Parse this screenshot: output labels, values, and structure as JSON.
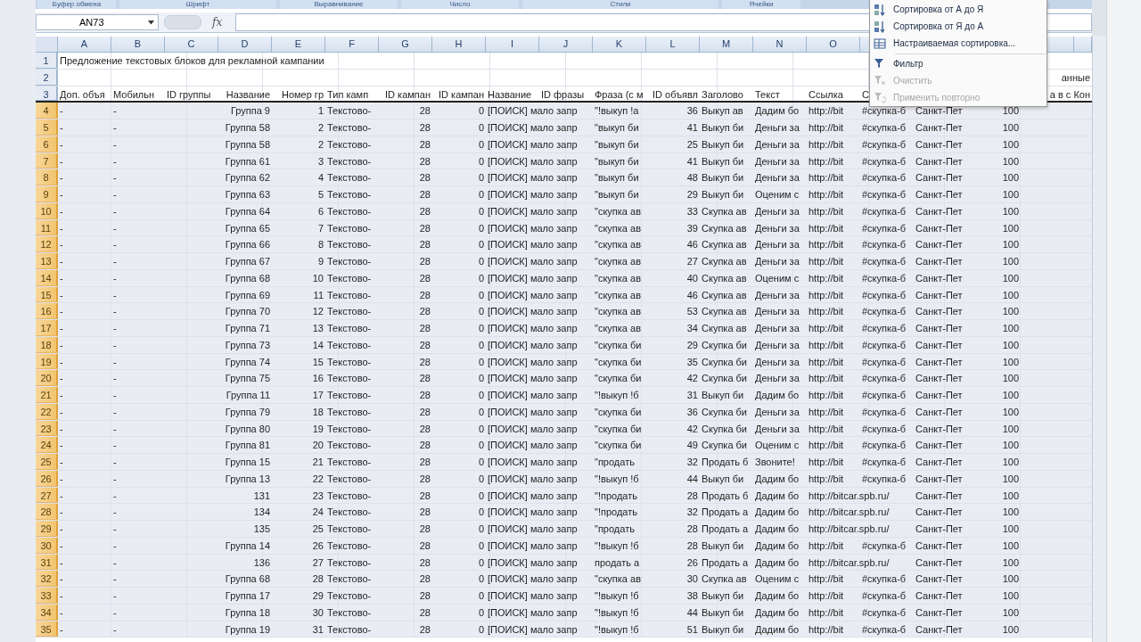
{
  "ribbon_groups": [
    {
      "label": "Буфер обмена"
    },
    {
      "label": "Шрифт"
    },
    {
      "label": "Выравнивание"
    },
    {
      "label": "Число"
    },
    {
      "label": "Стили"
    },
    {
      "label": "Ячейки"
    }
  ],
  "formula_bar": {
    "name_box": "AN73",
    "fx": "fx"
  },
  "columns": [
    "A",
    "B",
    "C",
    "D",
    "E",
    "F",
    "G",
    "H",
    "I",
    "J",
    "K",
    "L",
    "M",
    "N",
    "O"
  ],
  "rows": [
    {
      "num": "1",
      "kind": "title",
      "selected": false,
      "cells": {
        "A": "Предложение текстовых блоков для рекламной кампании"
      }
    },
    {
      "num": "2",
      "kind": "data",
      "selected": false,
      "cells": {
        "S": "анные"
      }
    },
    {
      "num": "3",
      "kind": "header",
      "selected": false,
      "cells": {
        "A": "Доп. объя",
        "B": "Мобильн",
        "C": "ID группы",
        "D": "Название",
        "E": "Номер гр",
        "F": "Тип камп",
        "G": "ID кампан",
        "H": "ID кампан",
        "I": "Название",
        "J": "ID фразы",
        "K": "Фраза (с м",
        "L": "ID объявл",
        "M": "Заголово",
        "N": "Текст",
        "O": "Ссылка",
        "P": "С",
        "S": "а в с Кон"
      }
    },
    {
      "num": "4",
      "kind": "data",
      "selected": true,
      "cells": {
        "A": "-",
        "B": "-",
        "D": "Группа 9",
        "E": "1",
        "F": "Текстово-",
        "G": "28",
        "H": "0",
        "I": "[ПОИСК] мало запр",
        "K": "\"!выкуп !а",
        "L": "36",
        "M": "Выкуп ав",
        "N": "Дадим бо",
        "O": "http://bit",
        "P": "#скупка-б",
        "Q": "Санкт-Пет",
        "R": "100"
      }
    },
    {
      "num": "5",
      "kind": "data",
      "selected": true,
      "cells": {
        "A": "-",
        "B": "-",
        "D": "Группа 58",
        "E": "2",
        "F": "Текстово-",
        "G": "28",
        "H": "0",
        "I": "[ПОИСК] мало запр",
        "K": "\"выкуп би",
        "L": "41",
        "M": "Выкуп би",
        "N": "Деньги за",
        "O": "http://bit",
        "P": "#скупка-б",
        "Q": "Санкт-Пет",
        "R": "100"
      }
    },
    {
      "num": "6",
      "kind": "data",
      "selected": true,
      "cells": {
        "A": "-",
        "B": "-",
        "D": "Группа 58",
        "E": "2",
        "F": "Текстово-",
        "G": "28",
        "H": "0",
        "I": "[ПОИСК] мало запр",
        "K": "\"выкуп би",
        "L": "25",
        "M": "Выкуп би",
        "N": "Деньги за",
        "O": "http://bit",
        "P": "#скупка-б",
        "Q": "Санкт-Пет",
        "R": "100"
      }
    },
    {
      "num": "7",
      "kind": "data",
      "selected": true,
      "cells": {
        "A": "-",
        "B": "-",
        "D": "Группа 61",
        "E": "3",
        "F": "Текстово-",
        "G": "28",
        "H": "0",
        "I": "[ПОИСК] мало запр",
        "K": "\"выкуп би",
        "L": "41",
        "M": "Выкуп би",
        "N": "Деньги за",
        "O": "http://bit",
        "P": "#скупка-б",
        "Q": "Санкт-Пет",
        "R": "100"
      }
    },
    {
      "num": "8",
      "kind": "data",
      "selected": true,
      "cells": {
        "A": "-",
        "B": "-",
        "D": "Группа 62",
        "E": "4",
        "F": "Текстово-",
        "G": "28",
        "H": "0",
        "I": "[ПОИСК] мало запр",
        "K": "\"выкуп би",
        "L": "48",
        "M": "Выкуп би",
        "N": "Деньги за",
        "O": "http://bit",
        "P": "#скупка-б",
        "Q": "Санкт-Пет",
        "R": "100"
      }
    },
    {
      "num": "9",
      "kind": "data",
      "selected": true,
      "cells": {
        "A": "-",
        "B": "-",
        "D": "Группа 63",
        "E": "5",
        "F": "Текстово-",
        "G": "28",
        "H": "0",
        "I": "[ПОИСК] мало запр",
        "K": "\"выкуп би",
        "L": "29",
        "M": "Выкуп би",
        "N": "Оценим с",
        "O": "http://bit",
        "P": "#скупка-б",
        "Q": "Санкт-Пет",
        "R": "100"
      }
    },
    {
      "num": "10",
      "kind": "data",
      "selected": true,
      "cells": {
        "A": "-",
        "B": "-",
        "D": "Группа 64",
        "E": "6",
        "F": "Текстово-",
        "G": "28",
        "H": "0",
        "I": "[ПОИСК] мало запр",
        "K": "\"скупка ав",
        "L": "33",
        "M": "Скупка ав",
        "N": "Деньги за",
        "O": "http://bit",
        "P": "#скупка-б",
        "Q": "Санкт-Пет",
        "R": "100"
      }
    },
    {
      "num": "11",
      "kind": "data",
      "selected": true,
      "cells": {
        "A": "-",
        "B": "-",
        "D": "Группа 65",
        "E": "7",
        "F": "Текстово-",
        "G": "28",
        "H": "0",
        "I": "[ПОИСК] мало запр",
        "K": "\"скупка ав",
        "L": "39",
        "M": "Скупка ав",
        "N": "Деньги за",
        "O": "http://bit",
        "P": "#скупка-б",
        "Q": "Санкт-Пет",
        "R": "100"
      }
    },
    {
      "num": "12",
      "kind": "data",
      "selected": true,
      "cells": {
        "A": "-",
        "B": "-",
        "D": "Группа 66",
        "E": "8",
        "F": "Текстово-",
        "G": "28",
        "H": "0",
        "I": "[ПОИСК] мало запр",
        "K": "\"скупка ав",
        "L": "46",
        "M": "Скупка ав",
        "N": "Деньги за",
        "O": "http://bit",
        "P": "#скупка-б",
        "Q": "Санкт-Пет",
        "R": "100"
      }
    },
    {
      "num": "13",
      "kind": "data",
      "selected": true,
      "cells": {
        "A": "-",
        "B": "-",
        "D": "Группа 67",
        "E": "9",
        "F": "Текстово-",
        "G": "28",
        "H": "0",
        "I": "[ПОИСК] мало запр",
        "K": "\"скупка ав",
        "L": "27",
        "M": "Скупка ав",
        "N": "Деньги за",
        "O": "http://bit",
        "P": "#скупка-б",
        "Q": "Санкт-Пет",
        "R": "100"
      }
    },
    {
      "num": "14",
      "kind": "data",
      "selected": true,
      "cells": {
        "A": "-",
        "B": "-",
        "D": "Группа 68",
        "E": "10",
        "F": "Текстово-",
        "G": "28",
        "H": "0",
        "I": "[ПОИСК] мало запр",
        "K": "\"скупка ав",
        "L": "40",
        "M": "Скупка ав",
        "N": "Оценим с",
        "O": "http://bit",
        "P": "#скупка-б",
        "Q": "Санкт-Пет",
        "R": "100"
      }
    },
    {
      "num": "15",
      "kind": "data",
      "selected": true,
      "cells": {
        "A": "-",
        "B": "-",
        "D": "Группа 69",
        "E": "11",
        "F": "Текстово-",
        "G": "28",
        "H": "0",
        "I": "[ПОИСК] мало запр",
        "K": "\"скупка ав",
        "L": "46",
        "M": "Скупка ав",
        "N": "Деньги за",
        "O": "http://bit",
        "P": "#скупка-б",
        "Q": "Санкт-Пет",
        "R": "100"
      }
    },
    {
      "num": "16",
      "kind": "data",
      "selected": true,
      "cells": {
        "A": "-",
        "B": "-",
        "D": "Группа 70",
        "E": "12",
        "F": "Текстово-",
        "G": "28",
        "H": "0",
        "I": "[ПОИСК] мало запр",
        "K": "\"скупка ав",
        "L": "53",
        "M": "Скупка ав",
        "N": "Деньги за",
        "O": "http://bit",
        "P": "#скупка-б",
        "Q": "Санкт-Пет",
        "R": "100"
      }
    },
    {
      "num": "17",
      "kind": "data",
      "selected": true,
      "cells": {
        "A": "-",
        "B": "-",
        "D": "Группа 71",
        "E": "13",
        "F": "Текстово-",
        "G": "28",
        "H": "0",
        "I": "[ПОИСК] мало запр",
        "K": "\"скупка ав",
        "L": "34",
        "M": "Скупка ав",
        "N": "Деньги за",
        "O": "http://bit",
        "P": "#скупка-б",
        "Q": "Санкт-Пет",
        "R": "100"
      }
    },
    {
      "num": "18",
      "kind": "data",
      "selected": true,
      "cells": {
        "A": "-",
        "B": "-",
        "D": "Группа 73",
        "E": "14",
        "F": "Текстово-",
        "G": "28",
        "H": "0",
        "I": "[ПОИСК] мало запр",
        "K": "\"скупка би",
        "L": "29",
        "M": "Скупка би",
        "N": "Деньги за",
        "O": "http://bit",
        "P": "#скупка-б",
        "Q": "Санкт-Пет",
        "R": "100"
      }
    },
    {
      "num": "19",
      "kind": "data",
      "selected": true,
      "cells": {
        "A": "-",
        "B": "-",
        "D": "Группа 74",
        "E": "15",
        "F": "Текстово-",
        "G": "28",
        "H": "0",
        "I": "[ПОИСК] мало запр",
        "K": "\"скупка би",
        "L": "35",
        "M": "Скупка би",
        "N": "Деньги за",
        "O": "http://bit",
        "P": "#скупка-б",
        "Q": "Санкт-Пет",
        "R": "100"
      }
    },
    {
      "num": "20",
      "kind": "data",
      "selected": true,
      "cells": {
        "A": "-",
        "B": "-",
        "D": "Группа 75",
        "E": "16",
        "F": "Текстово-",
        "G": "28",
        "H": "0",
        "I": "[ПОИСК] мало запр",
        "K": "\"скупка би",
        "L": "42",
        "M": "Скупка би",
        "N": "Деньги за",
        "O": "http://bit",
        "P": "#скупка-б",
        "Q": "Санкт-Пет",
        "R": "100"
      }
    },
    {
      "num": "21",
      "kind": "data",
      "selected": true,
      "cells": {
        "A": "-",
        "B": "-",
        "D": "Группа 11",
        "E": "17",
        "F": "Текстово-",
        "G": "28",
        "H": "0",
        "I": "[ПОИСК] мало запр",
        "K": "\"!выкуп !б",
        "L": "31",
        "M": "Выкуп би",
        "N": "Дадим бо",
        "O": "http://bit",
        "P": "#скупка-б",
        "Q": "Санкт-Пет",
        "R": "100"
      }
    },
    {
      "num": "22",
      "kind": "data",
      "selected": true,
      "cells": {
        "A": "-",
        "B": "-",
        "D": "Группа 79",
        "E": "18",
        "F": "Текстово-",
        "G": "28",
        "H": "0",
        "I": "[ПОИСК] мало запр",
        "K": "\"скупка би",
        "L": "36",
        "M": "Скупка би",
        "N": "Деньги за",
        "O": "http://bit",
        "P": "#скупка-б",
        "Q": "Санкт-Пет",
        "R": "100"
      }
    },
    {
      "num": "23",
      "kind": "data",
      "selected": true,
      "cells": {
        "A": "-",
        "B": "-",
        "D": "Группа 80",
        "E": "19",
        "F": "Текстово-",
        "G": "28",
        "H": "0",
        "I": "[ПОИСК] мало запр",
        "K": "\"скупка би",
        "L": "42",
        "M": "Скупка би",
        "N": "Деньги за",
        "O": "http://bit",
        "P": "#скупка-б",
        "Q": "Санкт-Пет",
        "R": "100"
      }
    },
    {
      "num": "24",
      "kind": "data",
      "selected": true,
      "cells": {
        "A": "-",
        "B": "-",
        "D": "Группа 81",
        "E": "20",
        "F": "Текстово-",
        "G": "28",
        "H": "0",
        "I": "[ПОИСК] мало запр",
        "K": "\"скупка би",
        "L": "49",
        "M": "Скупка би",
        "N": "Оценим с",
        "O": "http://bit",
        "P": "#скупка-б",
        "Q": "Санкт-Пет",
        "R": "100"
      }
    },
    {
      "num": "25",
      "kind": "data",
      "selected": true,
      "cells": {
        "A": "-",
        "B": "-",
        "D": "Группа 15",
        "E": "21",
        "F": "Текстово-",
        "G": "28",
        "H": "0",
        "I": "[ПОИСК] мало запр",
        "K": "\"продать",
        "L": "32",
        "M": "Продать б",
        "N": "Звоните!",
        "O": "http://bit",
        "P": "#скупка-б",
        "Q": "Санкт-Пет",
        "R": "100"
      }
    },
    {
      "num": "26",
      "kind": "data",
      "selected": true,
      "cells": {
        "A": "-",
        "B": "-",
        "D": "Группа 13",
        "E": "22",
        "F": "Текстово-",
        "G": "28",
        "H": "0",
        "I": "[ПОИСК] мало запр",
        "K": "\"!выкуп !б",
        "L": "44",
        "M": "Выкуп би",
        "N": "Дадим бо",
        "O": "http://bit",
        "P": "#скупка-б",
        "Q": "Санкт-Пет",
        "R": "100"
      }
    },
    {
      "num": "27",
      "kind": "data",
      "selected": true,
      "cells": {
        "A": "-",
        "B": "-",
        "D": "131",
        "E": "23",
        "F": "Текстово-",
        "G": "28",
        "H": "0",
        "I": "[ПОИСК] мало запр",
        "K": "\"!продать",
        "L": "28",
        "M": "Продать б",
        "N": "Дадим бо",
        "O": "http://bitcar.spb.ru/",
        "Q": "Санкт-Пет",
        "R": "100"
      }
    },
    {
      "num": "28",
      "kind": "data",
      "selected": true,
      "cells": {
        "A": "-",
        "B": "-",
        "D": "134",
        "E": "24",
        "F": "Текстово-",
        "G": "28",
        "H": "0",
        "I": "[ПОИСК] мало запр",
        "K": "\"!продать",
        "L": "32",
        "M": "Продать а",
        "N": "Дадим бо",
        "O": "http://bitcar.spb.ru/",
        "Q": "Санкт-Пет",
        "R": "100"
      }
    },
    {
      "num": "29",
      "kind": "data",
      "selected": true,
      "cells": {
        "A": "-",
        "B": "-",
        "D": "135",
        "E": "25",
        "F": "Текстово-",
        "G": "28",
        "H": "0",
        "I": "[ПОИСК] мало запр",
        "K": "\"продать",
        "L": "28",
        "M": "Продать а",
        "N": "Дадим бо",
        "O": "http://bitcar.spb.ru/",
        "Q": "Санкт-Пет",
        "R": "100"
      }
    },
    {
      "num": "30",
      "kind": "data",
      "selected": true,
      "cells": {
        "A": "-",
        "B": "-",
        "D": "Группа 14",
        "E": "26",
        "F": "Текстово-",
        "G": "28",
        "H": "0",
        "I": "[ПОИСК] мало запр",
        "K": "\"!выкуп !б",
        "L": "28",
        "M": "Выкуп би",
        "N": "Дадим бо",
        "O": "http://bit",
        "P": "#скупка-б",
        "Q": "Санкт-Пет",
        "R": "100"
      }
    },
    {
      "num": "31",
      "kind": "data",
      "selected": true,
      "cells": {
        "A": "-",
        "B": "-",
        "D": "136",
        "E": "27",
        "F": "Текстово-",
        "G": "28",
        "H": "0",
        "I": "[ПОИСК] мало запр",
        "K": "продать а",
        "L": "26",
        "M": "Продать а",
        "N": "Дадим бо",
        "O": "http://bitcar.spb.ru/",
        "Q": "Санкт-Пет",
        "R": "100"
      }
    },
    {
      "num": "32",
      "kind": "data",
      "selected": true,
      "cells": {
        "A": "-",
        "B": "-",
        "D": "Группа 68",
        "E": "28",
        "F": "Текстово-",
        "G": "28",
        "H": "0",
        "I": "[ПОИСК] мало запр",
        "K": "\"скупка ав",
        "L": "30",
        "M": "Скупка ав",
        "N": "Оценим с",
        "O": "http://bit",
        "P": "#скупка-б",
        "Q": "Санкт-Пет",
        "R": "100"
      }
    },
    {
      "num": "33",
      "kind": "data",
      "selected": true,
      "cells": {
        "A": "-",
        "B": "-",
        "D": "Группа 17",
        "E": "29",
        "F": "Текстово-",
        "G": "28",
        "H": "0",
        "I": "[ПОИСК] мало запр",
        "K": "\"!выкуп !б",
        "L": "38",
        "M": "Выкуп би",
        "N": "Дадим бо",
        "O": "http://bit",
        "P": "#скупка-б",
        "Q": "Санкт-Пет",
        "R": "100"
      }
    },
    {
      "num": "34",
      "kind": "data",
      "selected": true,
      "cells": {
        "A": "-",
        "B": "-",
        "D": "Группа 18",
        "E": "30",
        "F": "Текстово-",
        "G": "28",
        "H": "0",
        "I": "[ПОИСК] мало запр",
        "K": "\"!выкуп !б",
        "L": "44",
        "M": "Выкуп би",
        "N": "Дадим бо",
        "O": "http://bit",
        "P": "#скупка-б",
        "Q": "Санкт-Пет",
        "R": "100"
      }
    },
    {
      "num": "35",
      "kind": "data",
      "selected": true,
      "cells": {
        "A": "-",
        "B": "-",
        "D": "Группа 19",
        "E": "31",
        "F": "Текстово-",
        "G": "28",
        "H": "0",
        "I": "[ПОИСК] мало запр",
        "K": "\"!выкуп !б",
        "L": "51",
        "M": "Выкуп би",
        "N": "Дадим бо",
        "O": "http://bit",
        "P": "#скупка-б",
        "Q": "Санкт-Пет",
        "R": "100"
      }
    }
  ],
  "menu": {
    "items": [
      {
        "kind": "sort_asc",
        "label": "Сортировка от А до Я",
        "disabled": false
      },
      {
        "kind": "sort_desc",
        "label": "Сортировка от Я до А",
        "disabled": false
      },
      {
        "kind": "custom_sort",
        "label": "Настраиваемая сортировка...",
        "disabled": false
      },
      {
        "kind": "separator"
      },
      {
        "kind": "filter",
        "label": "Фильтр",
        "disabled": false
      },
      {
        "kind": "clear",
        "label": "Очистить",
        "disabled": true
      },
      {
        "kind": "reapply",
        "label": "Применить повторно",
        "disabled": true
      }
    ]
  }
}
